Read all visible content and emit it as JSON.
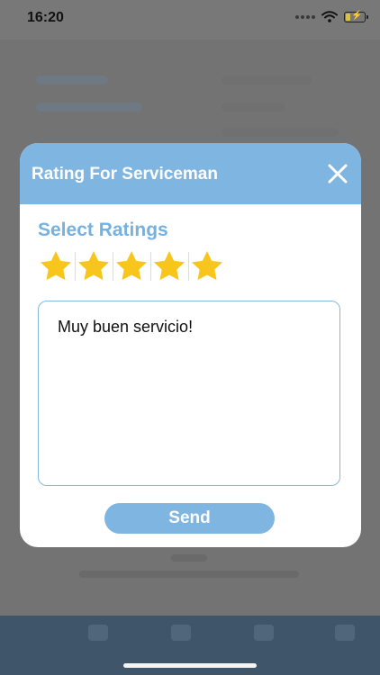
{
  "status_bar": {
    "time": "16:20",
    "icons": [
      "signal-dots-icon",
      "wifi-icon",
      "battery-charging-icon"
    ]
  },
  "modal": {
    "title": "Rating For Serviceman",
    "close_icon": "close-icon",
    "section_title": "Select Ratings",
    "rating": {
      "value": 5,
      "max": 5
    },
    "comment": "Muy buen servicio!",
    "send_label": "Send"
  },
  "colors": {
    "header": "#7fb5e1",
    "accent_text": "#76b1df",
    "star": "#f7c51b",
    "overlay": "#737373",
    "bottom_nav": "#3f5569"
  }
}
